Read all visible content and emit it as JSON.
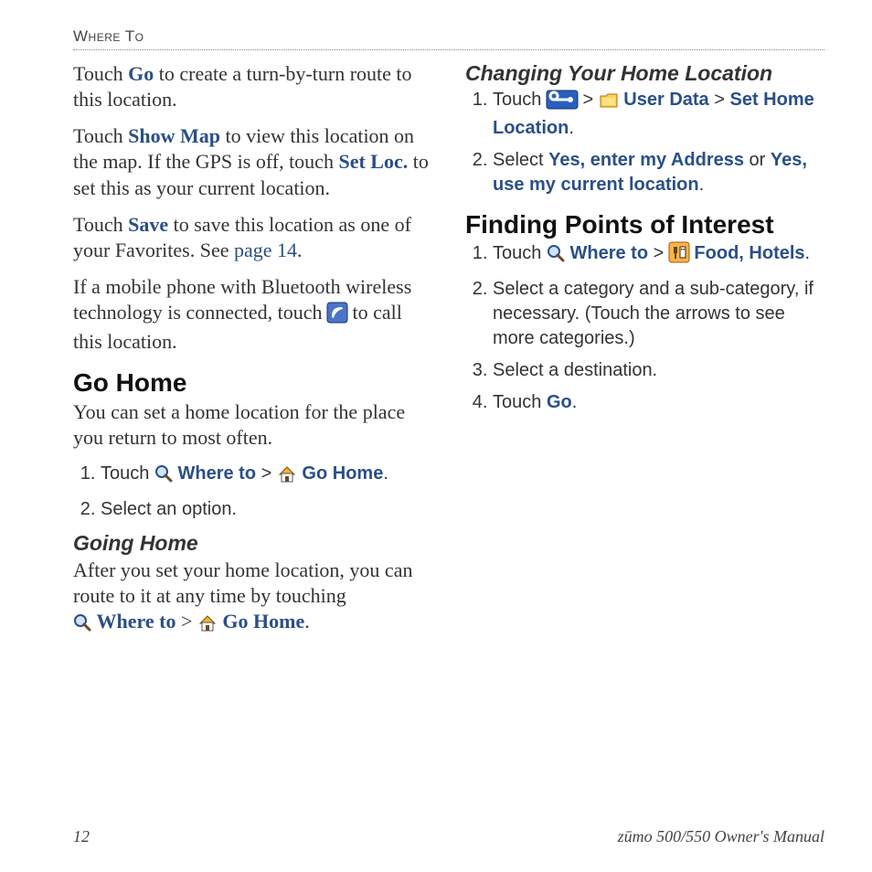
{
  "runningHead": "Where To",
  "left": {
    "p1_a": "Touch ",
    "p1_go": "Go",
    "p1_b": " to create a turn-by-turn route to this location.",
    "p2_a": "Touch ",
    "p2_showmap": "Show Map",
    "p2_b": " to view this location on the map. If the GPS is off, touch ",
    "p2_setloc": "Set Loc.",
    "p2_c": " to set this as your current location.",
    "p3_a": "Touch ",
    "p3_save": "Save",
    "p3_b": " to save this location as one of your Favorites. See ",
    "p3_page14": "page 14",
    "p3_c": ".",
    "p4_a": "If a mobile phone with Bluetooth wireless technology is connected, touch ",
    "p4_b": " to call this location.",
    "h_goHome": "Go Home",
    "p5": "You can set a home location for the place you return to most often.",
    "step1_a": "Touch ",
    "where_to": "Where to",
    "sep": " > ",
    "go_home": "Go Home",
    "step1_end": ".",
    "step2": "Select an option.",
    "h_goingHome": "Going Home",
    "p6_a": "After you set your home location, you can route to it at any time by touching "
  },
  "right": {
    "h_changing": "Changing Your Home Location",
    "c_step1_a": "Touch ",
    "user_data": "User Data",
    "set_home": "Set Home Location",
    "c_step1_end": ".",
    "c_step2_a": "Select ",
    "yes_addr": "Yes, enter my Address",
    "or": " or ",
    "yes_loc": "Yes, use my current location",
    "c_step2_end": ".",
    "h_poi": "Finding Points of Interest",
    "p_step1_a": "Touch ",
    "food_hotels": "Food, Hotels",
    "p_step1_end": ".",
    "p_step2": "Select a category and a sub-category, if necessary. (Touch the arrows to see more categories.)",
    "p_step3": "Select a destination.",
    "p_step4_a": "Touch ",
    "p_step4_go": "Go",
    "p_step4_end": "."
  },
  "footer": {
    "page": "12",
    "title": "zūmo 500/550 Owner's Manual"
  }
}
